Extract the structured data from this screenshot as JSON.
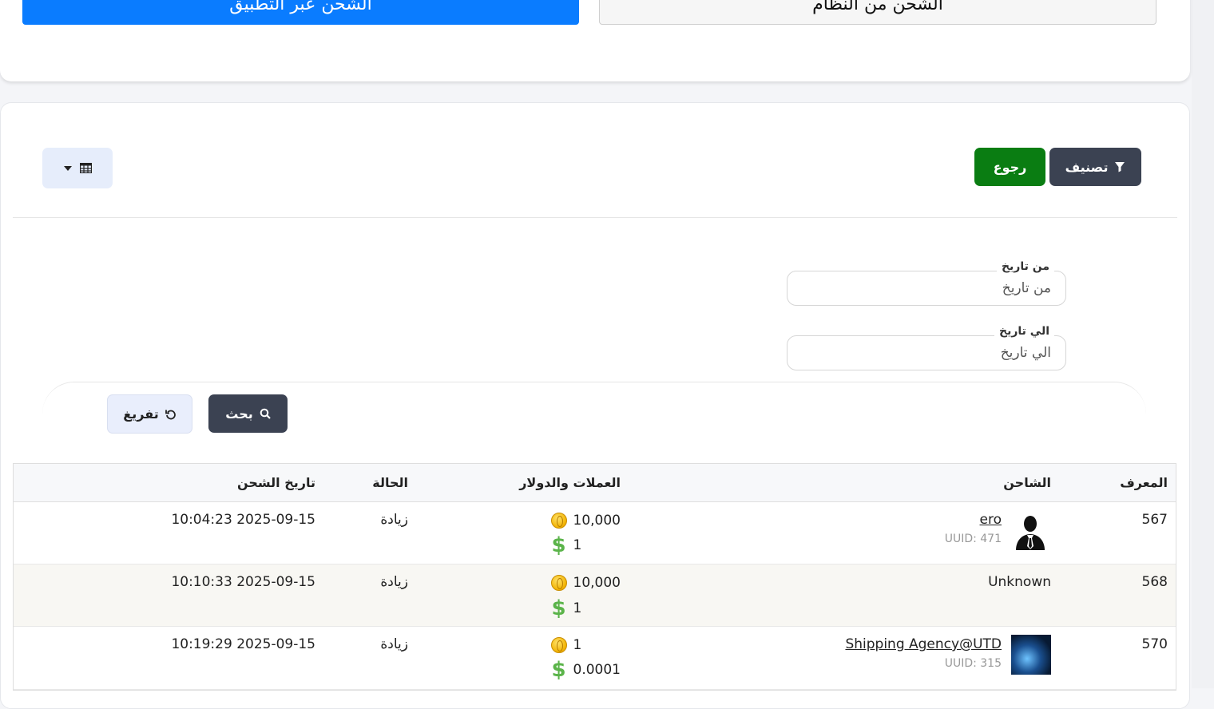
{
  "tabs": {
    "app": "الشحن عبر التطبيق",
    "system": "الشحن من النظام"
  },
  "toolbar": {
    "filter_label": "تصنيف",
    "back_label": "رجوع"
  },
  "filters": {
    "from_label": "من تاريخ",
    "from_placeholder": "من تاريخ",
    "to_label": "الي تاريخ",
    "to_placeholder": "الي تاريخ",
    "search_label": "بحث",
    "reset_label": "تفريغ"
  },
  "table": {
    "headers": {
      "id": "المعرف",
      "user": "الشاحن",
      "money": "العملات والدولار",
      "state": "الحالة",
      "date": "تاريخ الشحن"
    },
    "rows": [
      {
        "id": "567",
        "user": "ero",
        "uuid": "UUID: 471",
        "coins": "10,000",
        "dollars": "1",
        "state": "زيادة",
        "date": "2025-09-15 10:04:23"
      },
      {
        "id": "568",
        "user": "Unknown",
        "uuid": "",
        "coins": "10,000",
        "dollars": "1",
        "state": "زيادة",
        "date": "2025-09-15 10:10:33"
      },
      {
        "id": "570",
        "user": "Shipping Agency@UTD",
        "uuid": "UUID: 315",
        "coins": "1",
        "dollars": "0.0001",
        "state": "زيادة",
        "date": "2025-09-15 10:19:29"
      }
    ]
  },
  "colors": {
    "primary": "#0a7cff",
    "dark": "#3b4252",
    "green": "#0a7d12",
    "dollar": "#5bb44a",
    "coin": "#f2b200"
  },
  "icons": {
    "filter": "filter-icon",
    "table": "table-icon",
    "caret": "caret-down-icon",
    "search": "search-icon",
    "reset": "reset-icon",
    "coin": "coin-icon",
    "dollar": "dollar-icon",
    "avatar": "user-silhouette-icon"
  }
}
